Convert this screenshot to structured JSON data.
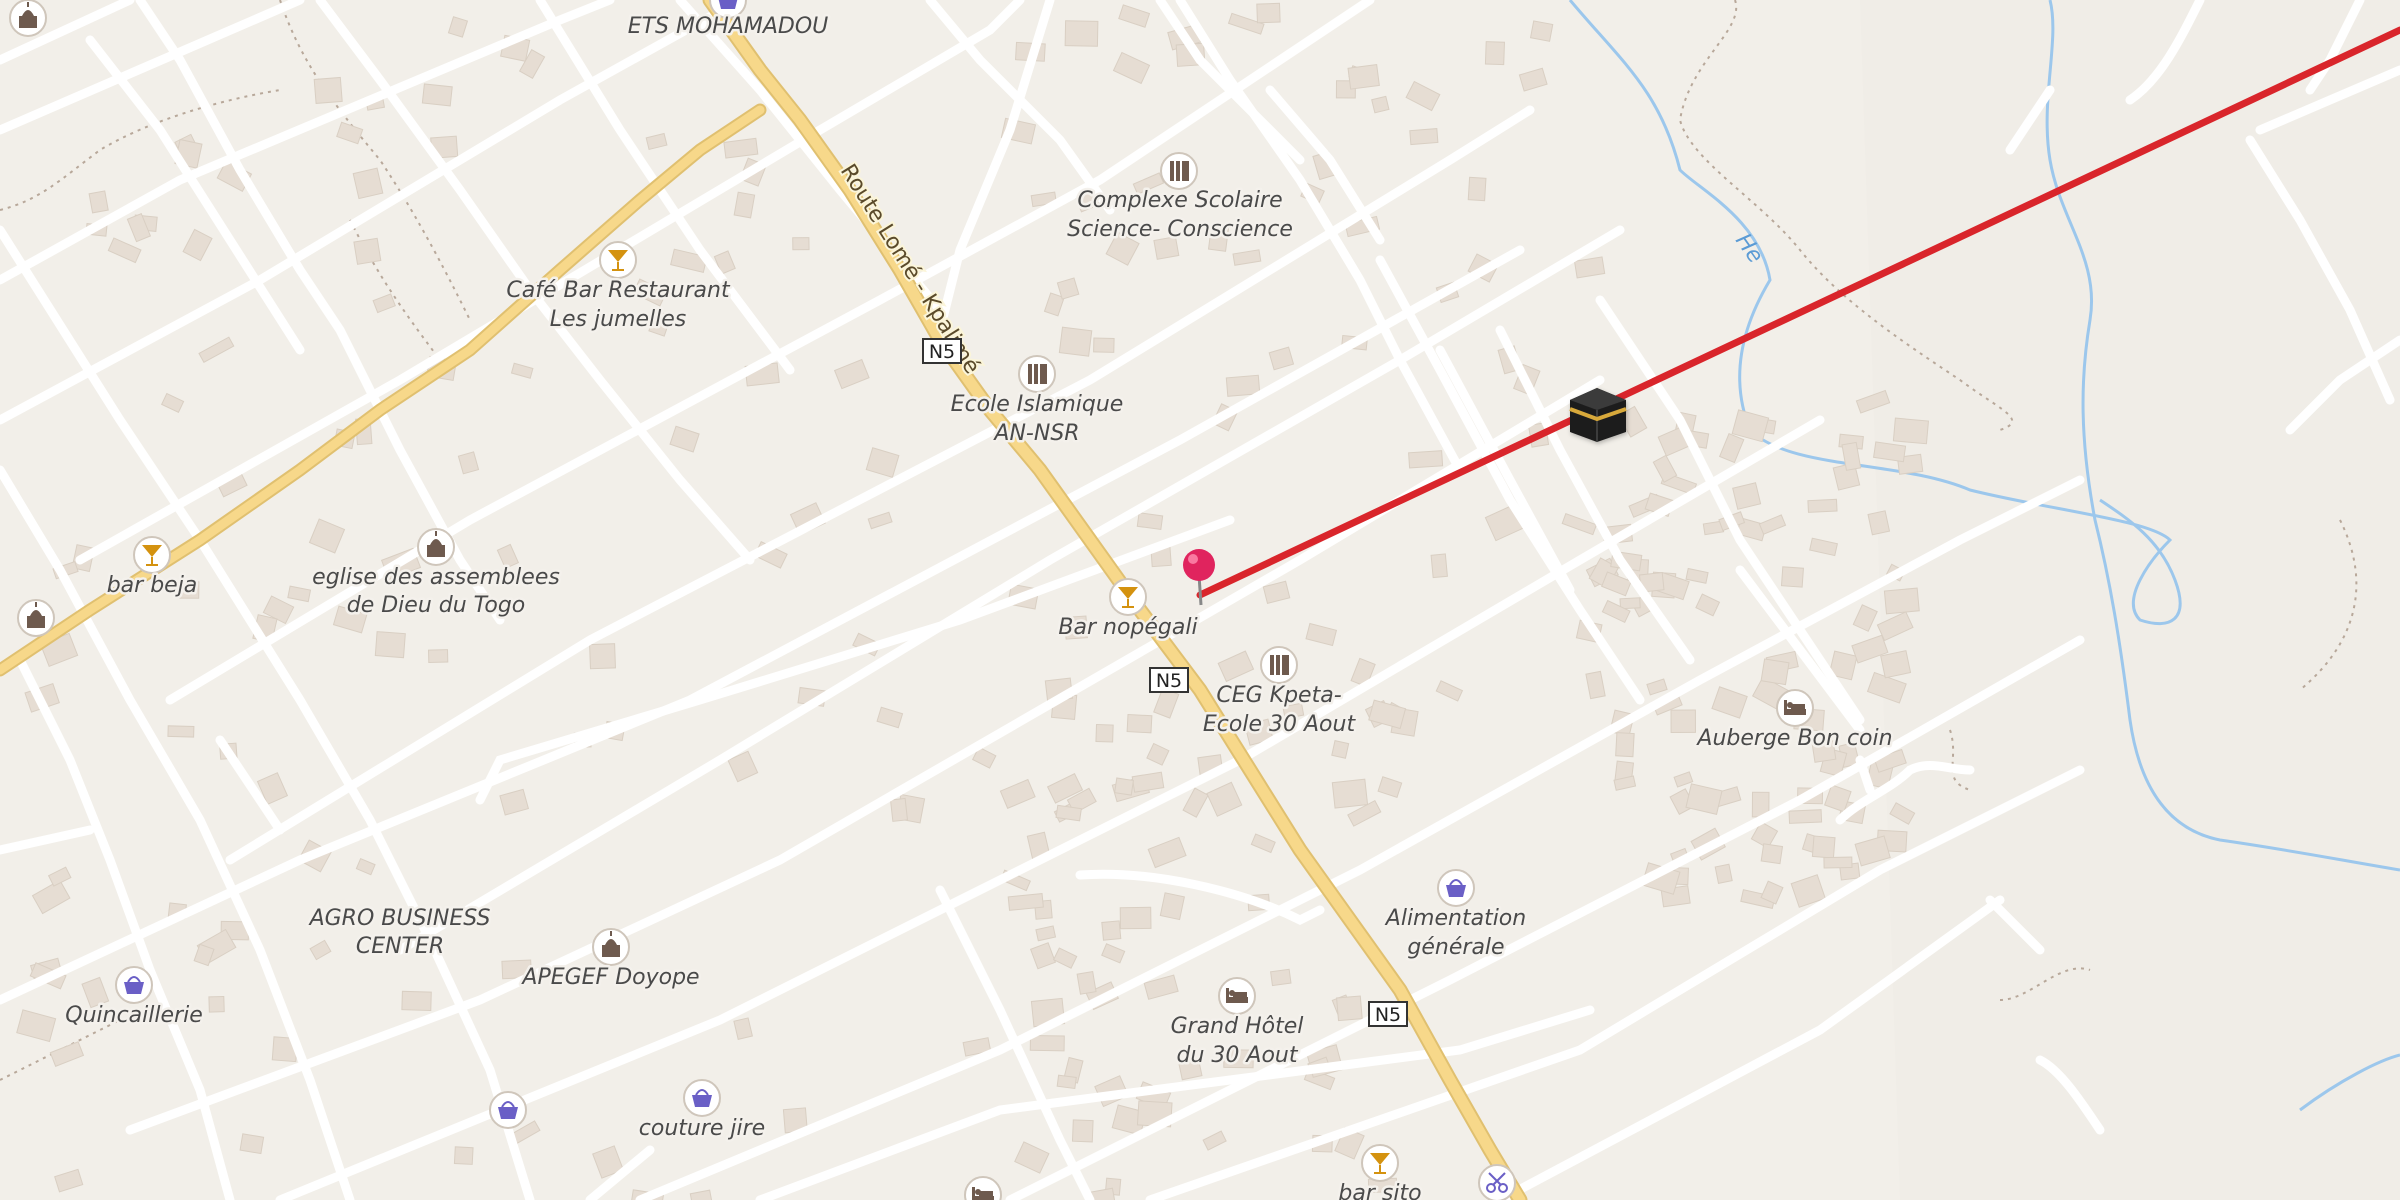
{
  "map": {
    "road_name": "Route Lomé - Kpalimé",
    "road_ref": "N5",
    "stream_name": "He",
    "pois": [
      {
        "id": "ets-mohamadou",
        "label": "ETS MOHAMADOU",
        "icon": "shop-basket-icon"
      },
      {
        "id": "complexe-scolaire",
        "label1": "Complexe Scolaire",
        "label2": "Science- Conscience",
        "icon": "school-icon"
      },
      {
        "id": "cafe-bar",
        "label1": "Café Bar Restaurant",
        "label2": "Les jumelles",
        "icon": "bar-cocktail-icon"
      },
      {
        "id": "ecole-islamique",
        "label1": "Ecole Islamique",
        "label2": "AN-NSR",
        "icon": "school-icon"
      },
      {
        "id": "bar-beja",
        "label": "bar beja",
        "icon": "bar-cocktail-icon"
      },
      {
        "id": "eglise",
        "label1": "eglise des assemblees",
        "label2": "de Dieu du Togo",
        "icon": "place-of-worship-icon"
      },
      {
        "id": "bar-nopegali",
        "label": "Bar nopégali",
        "icon": "bar-cocktail-icon"
      },
      {
        "id": "ceg-kpeta",
        "label1": "CEG Kpeta-",
        "label2": "Ecole 30 Aout",
        "icon": "school-icon"
      },
      {
        "id": "auberge",
        "label": "Auberge Bon coin",
        "icon": "hotel-bed-icon"
      },
      {
        "id": "alimentation",
        "label1": "Alimentation",
        "label2": "générale",
        "icon": "shop-basket-icon"
      },
      {
        "id": "agro",
        "label1": "AGRO BUSINESS",
        "label2": "CENTER"
      },
      {
        "id": "apegef",
        "label": "APEGEF Doyope",
        "icon": "place-of-worship-icon"
      },
      {
        "id": "quincaillerie",
        "label": "Quincaillerie",
        "icon": "shop-basket-icon"
      },
      {
        "id": "couture",
        "label": "couture jire",
        "icon": "shop-basket-icon"
      },
      {
        "id": "grand-hotel",
        "label1": "Grand Hôtel",
        "label2": "du 30 Aout",
        "icon": "hotel-bed-icon"
      },
      {
        "id": "bar-sito",
        "label": "bar sito",
        "icon": "bar-cocktail-icon"
      }
    ],
    "markers": {
      "pin": "location-pin-icon",
      "destination": "kaaba-icon",
      "bearing_line_color": "#d9252b"
    },
    "colors": {
      "background": "#f2efe9",
      "minor_road": "#ffffff",
      "major_road": "#f7d88a",
      "water": "#9cc7ec",
      "building": "#e6ddd3",
      "poi_icon": "#6e5a4e",
      "shop_icon": "#6a5fc6",
      "bar_icon": "#d4920f"
    }
  }
}
